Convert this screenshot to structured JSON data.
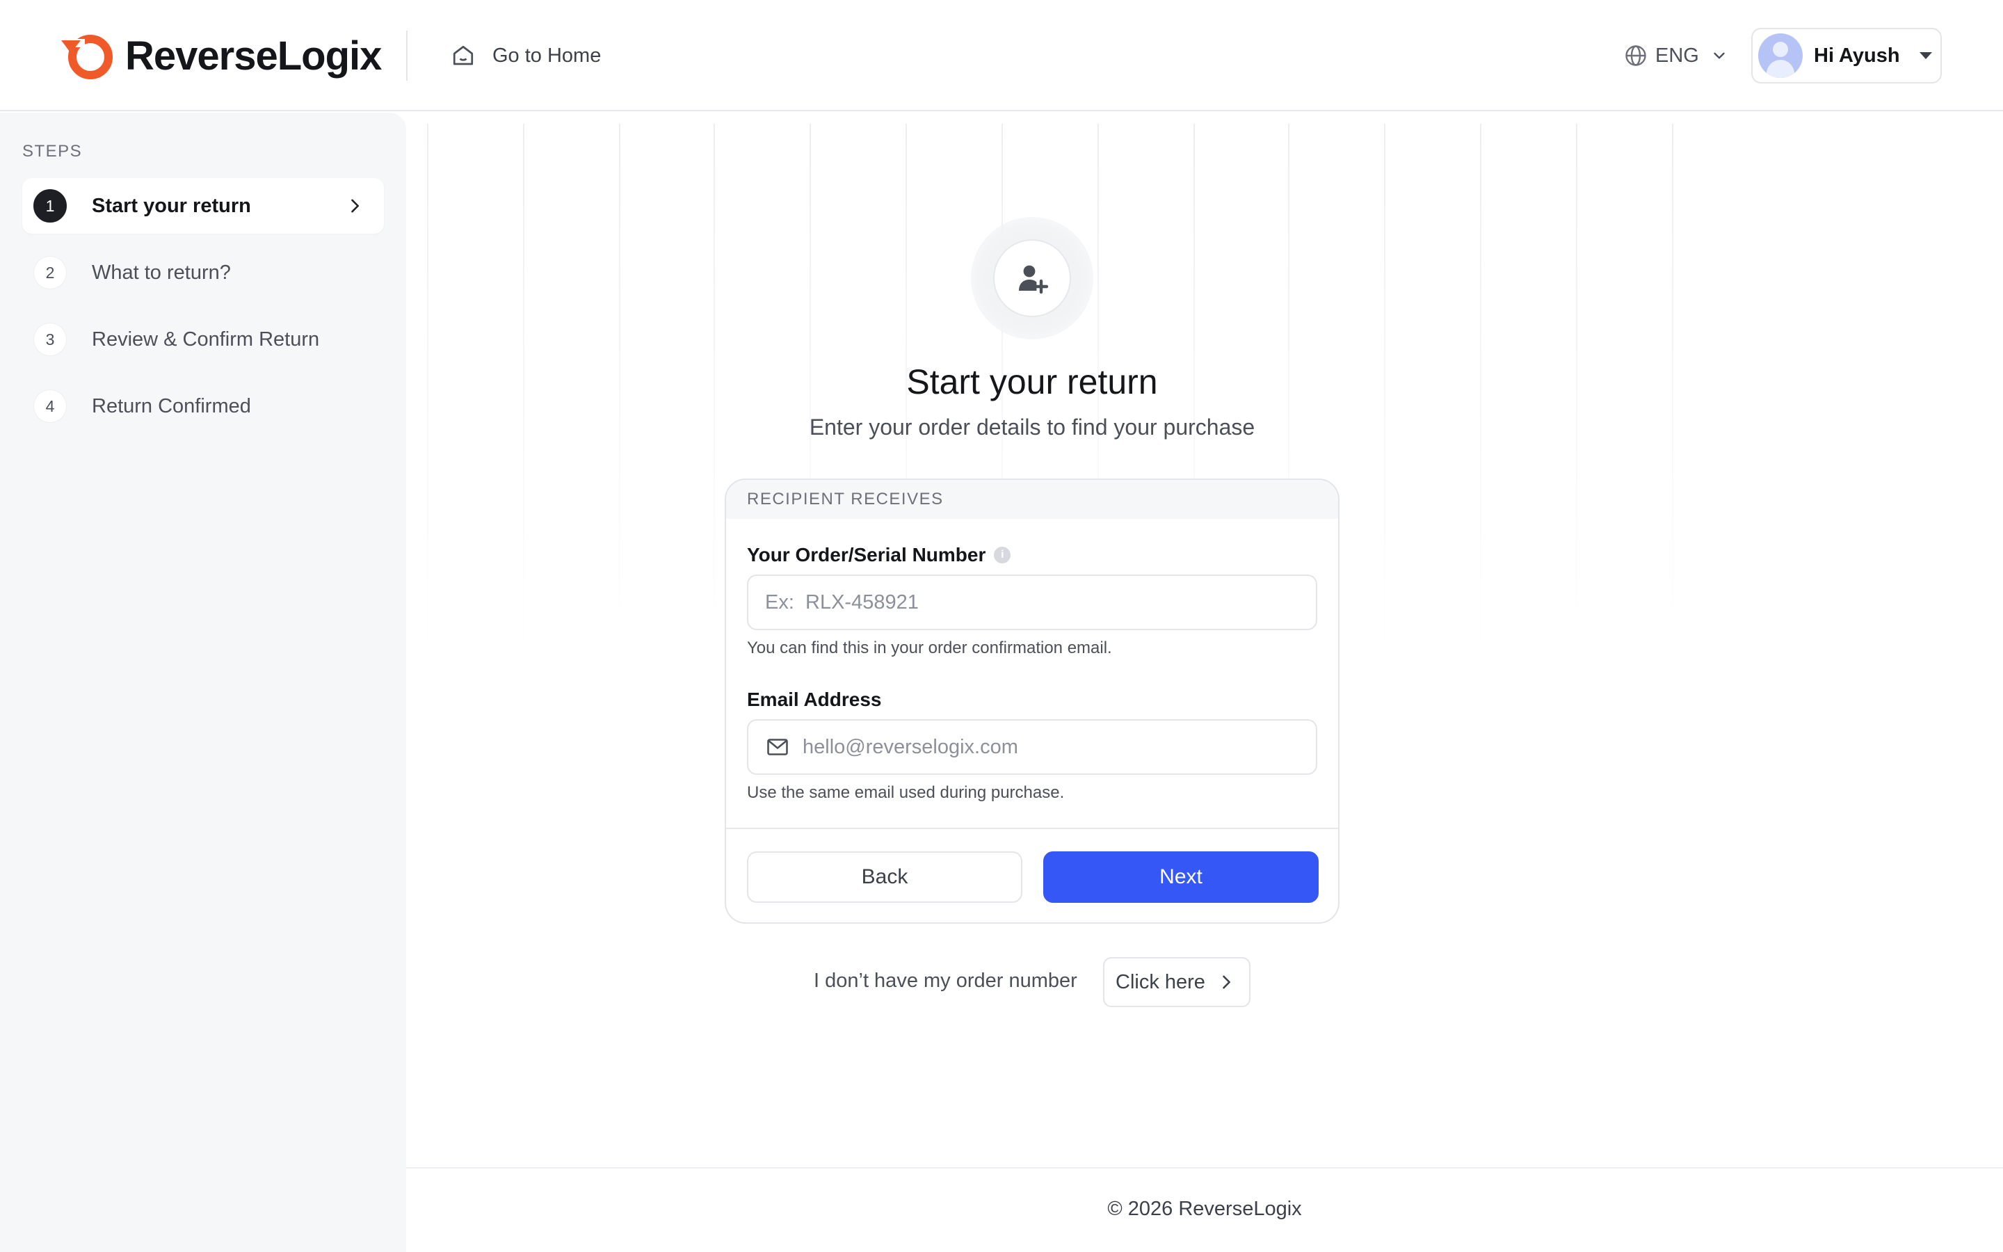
{
  "header": {
    "brand": "ReverseLogix",
    "home_link": "Go to Home",
    "language": "ENG",
    "user_greeting": "Hi Ayush"
  },
  "icons": {
    "logo": "reverselogix-logo-icon",
    "home": "home-icon",
    "language": "globe-icon",
    "language_caret": "chevron-down-icon",
    "user_caret": "caret-down-icon",
    "step_arrow": "chevron-right-icon",
    "hero": "add-user-icon",
    "info": "info-icon",
    "email": "mail-icon",
    "click_here_arrow": "chevron-right-icon"
  },
  "colors": {
    "brand_orange": "#f05a28",
    "primary_button": "#3557f6",
    "active_step": "#1d1f24"
  },
  "sidebar": {
    "title": "STEPS",
    "steps": [
      {
        "number": "1",
        "label": "Start your return",
        "active": true
      },
      {
        "number": "2",
        "label": "What to return?",
        "active": false
      },
      {
        "number": "3",
        "label": "Review & Confirm Return",
        "active": false
      },
      {
        "number": "4",
        "label": "Return Confirmed",
        "active": false
      }
    ]
  },
  "main": {
    "title": "Start your return",
    "subtitle": "Enter your order details to find your purchase",
    "card": {
      "section_title": "RECIPIENT RECEIVES",
      "order_field": {
        "label": "Your Order/Serial Number",
        "value": "",
        "placeholder": "Ex:  RLX-458921",
        "helper": "You can find this in your order confirmation email."
      },
      "email_field": {
        "label": "Email Address",
        "value": "",
        "placeholder": "hello@reverselogix.com",
        "helper": "Use the same email used during purchase."
      },
      "back_label": "Back",
      "next_label": "Next"
    },
    "no_order_text": "I don’t have my order number",
    "click_here_label": "Click here"
  },
  "footer": {
    "copyright": "© 2026 ReverseLogix"
  }
}
